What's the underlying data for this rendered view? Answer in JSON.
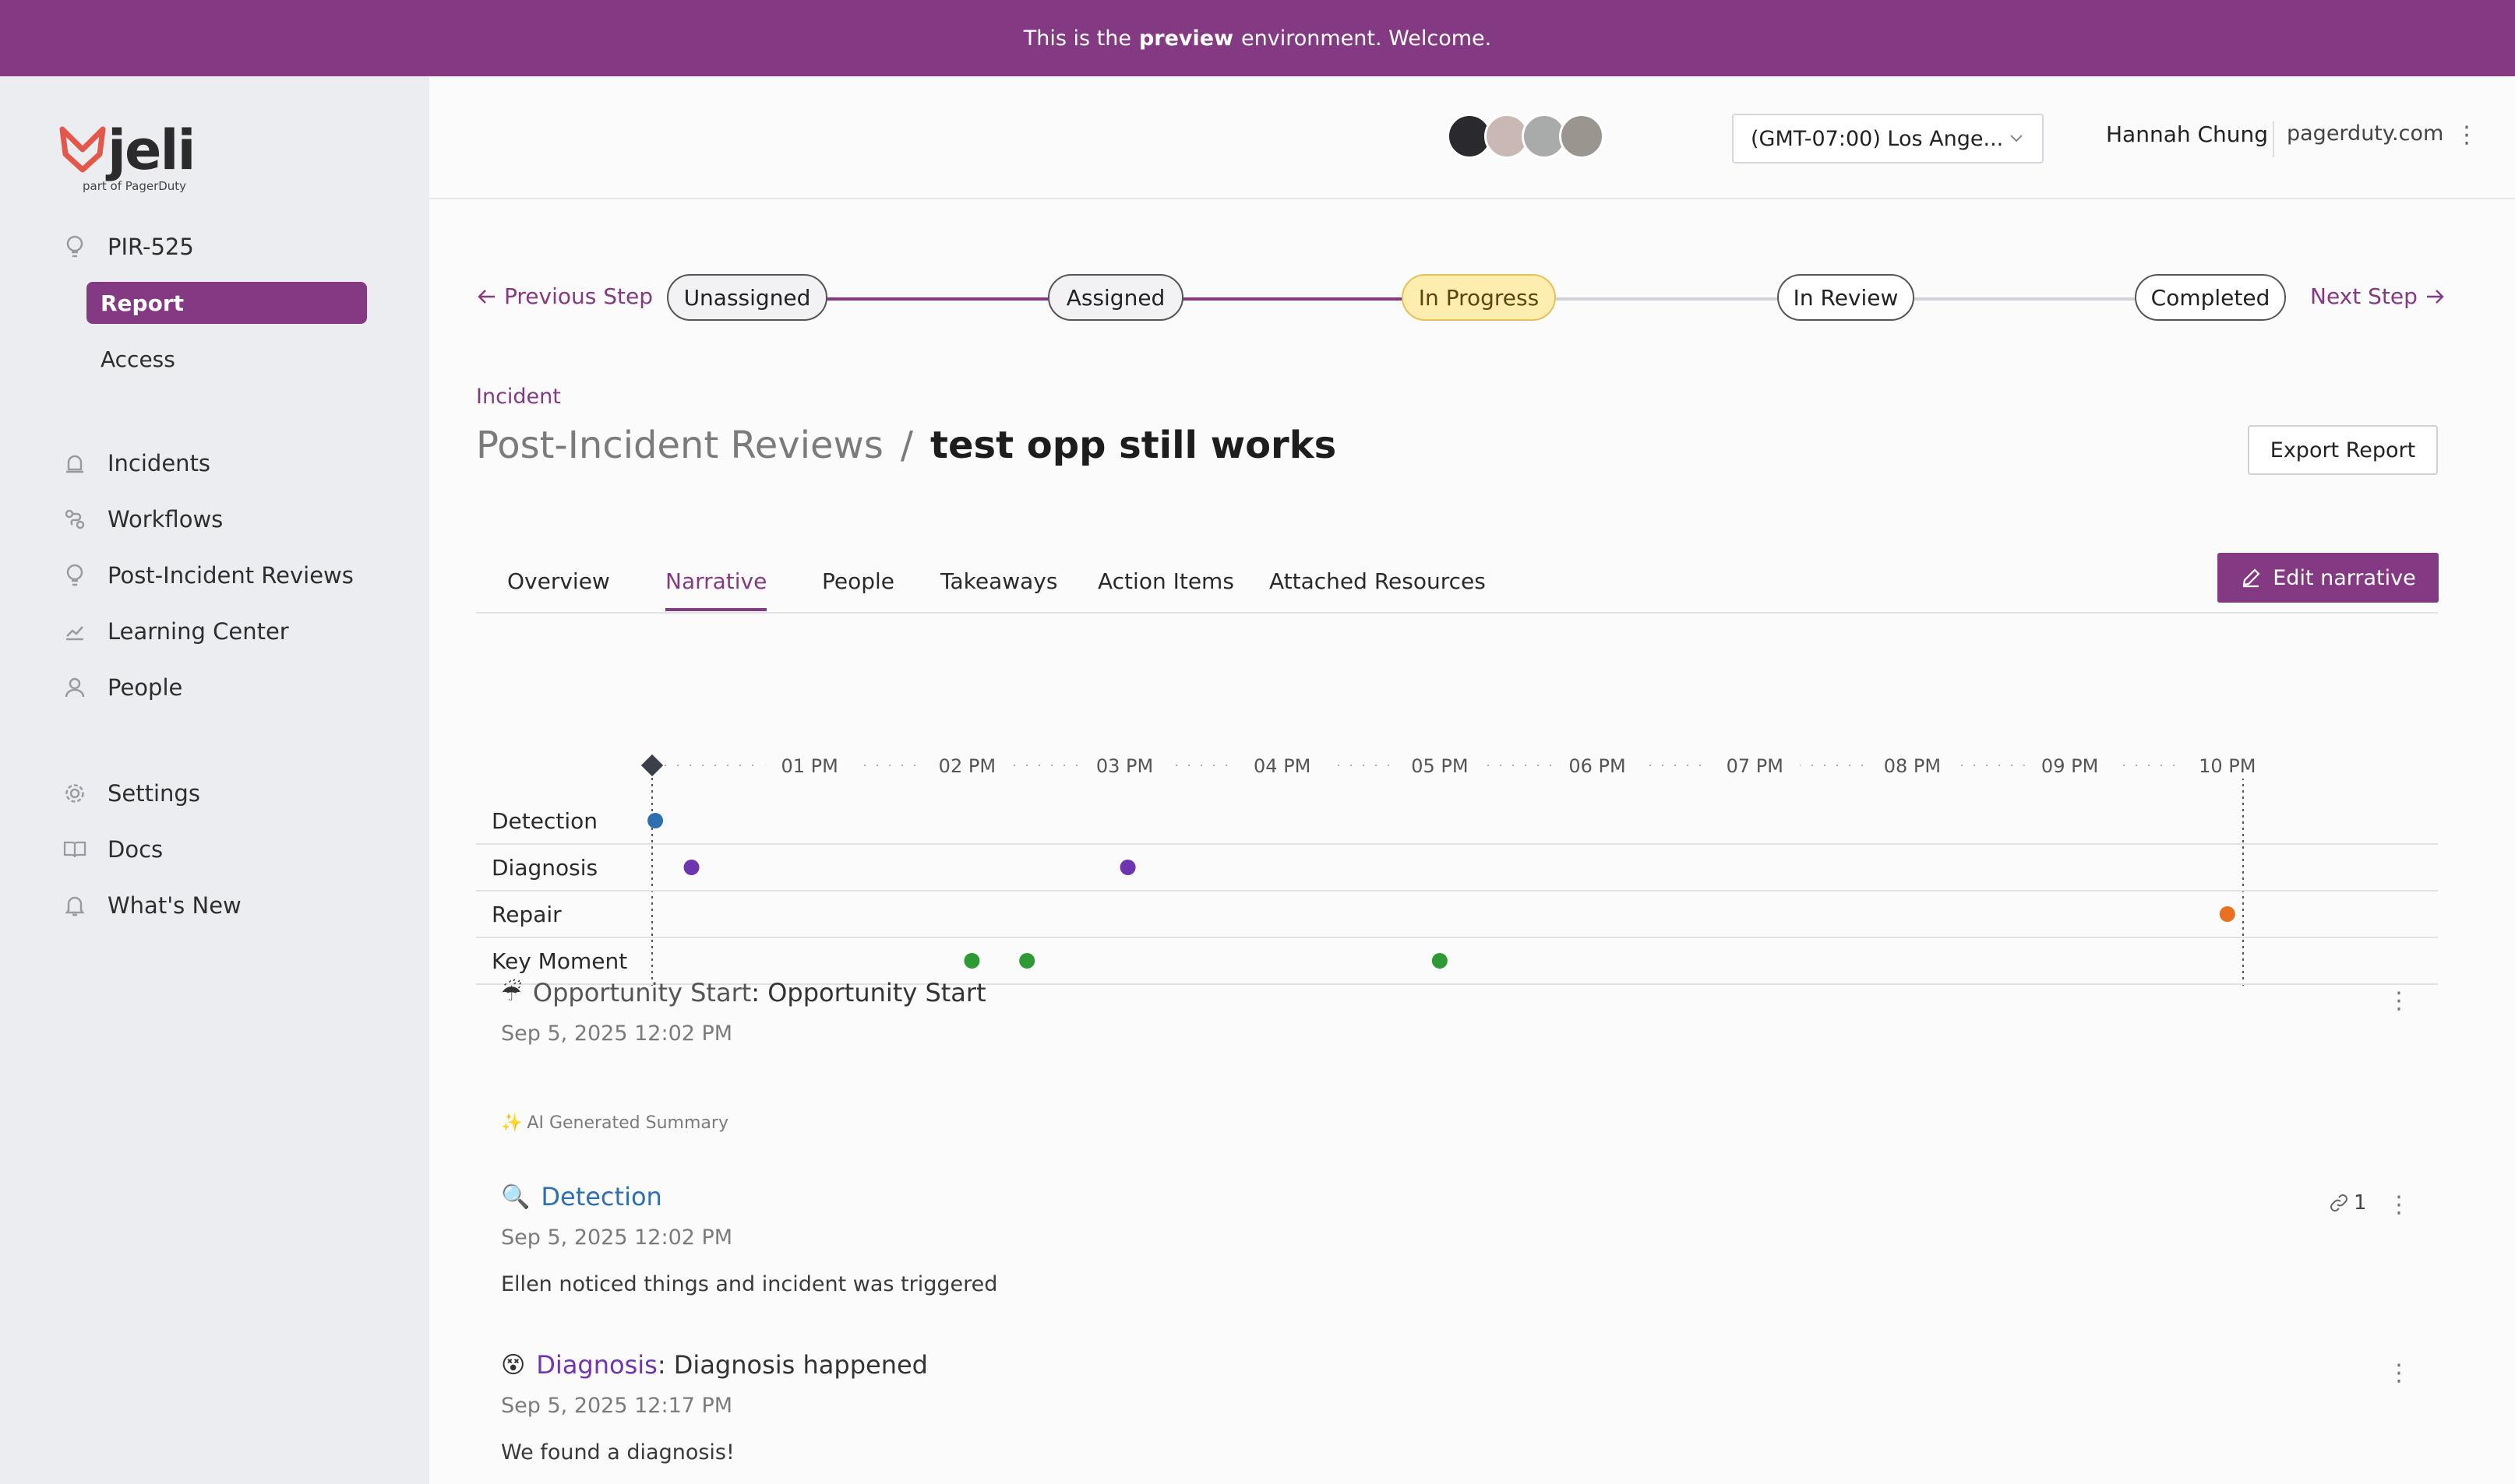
{
  "banner": {
    "prefix": "This is the",
    "bold": "preview",
    "suffix": "environment. Welcome."
  },
  "logo": {
    "name": "jeli",
    "tagline": "part of PagerDuty"
  },
  "sidebar": {
    "pir_id": "PIR-525",
    "sub_items": [
      {
        "label": "Report",
        "active": true
      },
      {
        "label": "Access",
        "active": false
      }
    ],
    "nav": [
      {
        "label": "Incidents",
        "icon": "siren-icon"
      },
      {
        "label": "Workflows",
        "icon": "workflow-icon"
      },
      {
        "label": "Post-Incident Reviews",
        "icon": "lightbulb-icon"
      },
      {
        "label": "Learning Center",
        "icon": "chart-line-icon"
      },
      {
        "label": "People",
        "icon": "person-icon"
      }
    ],
    "bottom_nav": [
      {
        "label": "Settings",
        "icon": "gear-icon"
      },
      {
        "label": "Docs",
        "icon": "book-icon"
      },
      {
        "label": "What's New",
        "icon": "bell-icon"
      }
    ]
  },
  "topbar": {
    "timezone": "(GMT-07:00) Los Ange...",
    "user": "Hannah Chung",
    "domain": "pagerduty.com"
  },
  "steps": {
    "previous": "Previous Step",
    "next": "Next Step",
    "items": [
      {
        "label": "Unassigned",
        "state": "done"
      },
      {
        "label": "Assigned",
        "state": "done"
      },
      {
        "label": "In Progress",
        "state": "current"
      },
      {
        "label": "In Review",
        "state": "future"
      },
      {
        "label": "Completed",
        "state": "future"
      }
    ]
  },
  "header": {
    "crumb": "Incident",
    "parent": "Post-Incident Reviews",
    "separator": "/",
    "title": "test opp still works",
    "export_label": "Export Report"
  },
  "tabs": [
    {
      "label": "Overview",
      "active": false
    },
    {
      "label": "Narrative",
      "active": true
    },
    {
      "label": "People",
      "active": false
    },
    {
      "label": "Takeaways",
      "active": false
    },
    {
      "label": "Action Items",
      "active": false
    },
    {
      "label": "Attached Resources",
      "active": false
    }
  ],
  "edit_label": "Edit narrative",
  "timeline": {
    "ticks": [
      "01 PM",
      "02 PM",
      "03 PM",
      "04 PM",
      "05 PM",
      "06 PM",
      "07 PM",
      "08 PM",
      "09 PM",
      "10 PM"
    ],
    "start_hour": 12.0,
    "end_hour": 22.1,
    "rows": [
      {
        "label": "Detection",
        "color": "#2f6fb0",
        "hours": [
          12.02
        ]
      },
      {
        "label": "Diagnosis",
        "color": "#6f34b0",
        "hours": [
          12.25,
          15.02
        ]
      },
      {
        "label": "Repair",
        "color": "#e8701f",
        "hours": [
          22.0
        ]
      },
      {
        "label": "Key Moment",
        "color": "#2e9a35",
        "hours": [
          14.03,
          14.38,
          17.0
        ]
      }
    ]
  },
  "entries": [
    {
      "emoji": "☔",
      "kind": "Opportunity Start",
      "title": "Opportunity Start",
      "date": "Sep 5, 2025 12:02 PM"
    },
    {
      "emoji": "🔍",
      "kind": "Detection",
      "title": "",
      "date": "Sep 5, 2025 12:02 PM",
      "body": "Ellen noticed things and incident was triggered",
      "links": "1"
    },
    {
      "emoji": "😵",
      "kind": "Diagnosis",
      "title": "Diagnosis happened",
      "date": "Sep 5, 2025 12:17 PM",
      "body": "We found a diagnosis!"
    }
  ],
  "ai_summary_label": "AI Generated Summary"
}
